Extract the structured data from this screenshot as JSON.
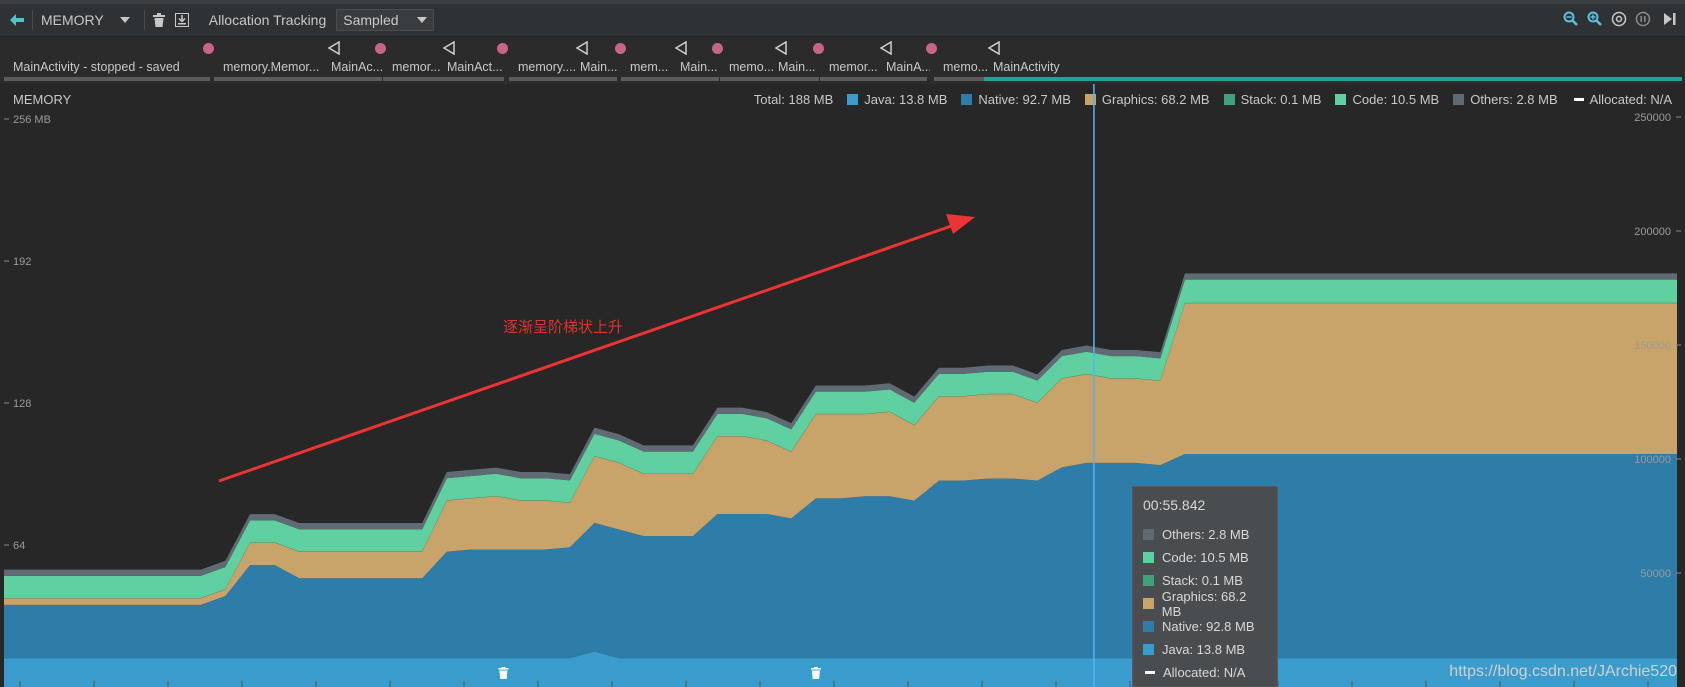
{
  "toolbar": {
    "back_icon": "back-arrow-icon",
    "memory_label": "MEMORY",
    "allocation_label": "Allocation Tracking",
    "sampling_value": "Sampled",
    "icons": [
      "delete-icon",
      "save-icon",
      "zoom-out-icon",
      "zoom-in-icon",
      "reset-zoom-icon",
      "pause-icon",
      "jump-to-end-icon"
    ]
  },
  "events": [
    {
      "label": "MainActivity - stopped - saved"
    },
    {
      "label": "memory.Memor..."
    },
    {
      "label": "MainAc..."
    },
    {
      "label": "memor..."
    },
    {
      "label": "MainAct..."
    },
    {
      "label": "memory...."
    },
    {
      "label": "Main..."
    },
    {
      "label": "mem..."
    },
    {
      "label": "Main..."
    },
    {
      "label": "memo..."
    },
    {
      "label": "Main..."
    },
    {
      "label": "memor..."
    },
    {
      "label": "MainA..."
    },
    {
      "label": "memo..."
    },
    {
      "label": "MainActivity"
    }
  ],
  "memory_panel": {
    "title": "MEMORY",
    "legend": {
      "total": "Total: 188 MB",
      "java": "Java: 13.8 MB",
      "native": "Native: 92.7 MB",
      "graphics": "Graphics: 68.2 MB",
      "stack": "Stack: 0.1 MB",
      "code": "Code: 10.5 MB",
      "others": "Others: 2.8 MB",
      "allocated": "Allocated: N/A"
    },
    "colors": {
      "java": "#3a9ccc",
      "native": "#2e7ca8",
      "graphics": "#c9a46a",
      "stack": "#3fa27a",
      "code": "#61d0a0",
      "others": "#5f6b74",
      "cursor": "#5ab0f0"
    }
  },
  "annotation": "逐渐呈阶梯状上升",
  "tooltip": {
    "time": "00:55.842",
    "rows": [
      {
        "label": "Others: 2.8 MB",
        "color": "#5f6b74"
      },
      {
        "label": "Code: 10.5 MB",
        "color": "#61d0a0"
      },
      {
        "label": "Stack: 0.1 MB",
        "color": "#3fa27a"
      },
      {
        "label": "Graphics: 68.2 MB",
        "color": "#c9a46a"
      },
      {
        "label": "Native: 92.8 MB",
        "color": "#2e7ca8"
      },
      {
        "label": "Java: 13.8 MB",
        "color": "#3a9ccc"
      },
      {
        "label": "Allocated: N/A",
        "color": "#ffffff"
      }
    ]
  },
  "watermark": "https://blog.csdn.net/JArchie520",
  "chart_data": {
    "type": "area",
    "stacked": true,
    "left_axis": {
      "unit": "MB",
      "ticks": [
        "256 MB",
        "192",
        "128",
        "64"
      ],
      "range": [
        0,
        256
      ]
    },
    "right_axis": {
      "ticks": [
        "250000",
        "200000",
        "150000",
        "100000",
        "50000"
      ],
      "range": [
        0,
        250000
      ]
    },
    "grid": false,
    "legend_position": "top-right",
    "x": [
      0,
      1,
      2,
      3,
      4,
      5,
      6,
      7,
      8,
      9,
      10,
      11,
      12,
      13,
      14,
      15,
      16,
      17,
      18,
      19,
      20,
      21,
      22,
      23,
      24,
      25,
      26,
      27,
      28,
      29,
      30,
      31,
      32,
      33,
      34,
      35,
      36,
      37,
      38,
      39,
      40,
      41,
      42,
      43,
      44,
      45,
      46,
      47,
      48,
      49,
      50,
      51,
      52,
      53,
      54,
      55,
      56,
      57,
      58,
      59,
      60,
      61,
      62,
      63,
      64,
      65,
      66,
      67,
      68
    ],
    "series": [
      {
        "name": "Java",
        "values": [
          13,
          13,
          13,
          13,
          13,
          13,
          13,
          13,
          13,
          13,
          13,
          13,
          13,
          13,
          13,
          13,
          13,
          13,
          13,
          13,
          13,
          13,
          13,
          13,
          16,
          13,
          13,
          13,
          13,
          13,
          13,
          13,
          13,
          13,
          13,
          13,
          13,
          13,
          13,
          13,
          13,
          13,
          13,
          13,
          13,
          13,
          13,
          13,
          13,
          13,
          13,
          13,
          13,
          13,
          13,
          13,
          13,
          13,
          13,
          13,
          13,
          13,
          13,
          13,
          13,
          13,
          13,
          13,
          13
        ]
      },
      {
        "name": "Native",
        "values": [
          24,
          24,
          24,
          24,
          24,
          24,
          24,
          24,
          24,
          28,
          42,
          42,
          36,
          36,
          36,
          36,
          36,
          36,
          48,
          49,
          49,
          49,
          49,
          50,
          58,
          58,
          55,
          55,
          55,
          65,
          65,
          65,
          63,
          72,
          72,
          73,
          73,
          71,
          80,
          80,
          81,
          81,
          80,
          86,
          88,
          88,
          88,
          87,
          92,
          92,
          92,
          92,
          92,
          92,
          92,
          92,
          92,
          92,
          92,
          92,
          92,
          92,
          92,
          92,
          92,
          92,
          92,
          92,
          92
        ]
      },
      {
        "name": "Graphics",
        "values": [
          3,
          3,
          3,
          3,
          3,
          3,
          3,
          3,
          3,
          3,
          10,
          10,
          12,
          12,
          12,
          12,
          12,
          12,
          23,
          23,
          24,
          22,
          22,
          20,
          30,
          30,
          28,
          28,
          28,
          35,
          35,
          33,
          30,
          38,
          38,
          37,
          38,
          34,
          38,
          38,
          38,
          38,
          35,
          40,
          40,
          38,
          38,
          38,
          68,
          68,
          68,
          68,
          68,
          68,
          68,
          68,
          68,
          68,
          68,
          68,
          68,
          68,
          68,
          68,
          68,
          68,
          68,
          68,
          68
        ]
      },
      {
        "name": "Stack",
        "values": [
          0.1,
          0.1,
          0.1,
          0.1,
          0.1,
          0.1,
          0.1,
          0.1,
          0.1,
          0.1,
          0.1,
          0.1,
          0.1,
          0.1,
          0.1,
          0.1,
          0.1,
          0.1,
          0.1,
          0.1,
          0.1,
          0.1,
          0.1,
          0.1,
          0.1,
          0.1,
          0.1,
          0.1,
          0.1,
          0.1,
          0.1,
          0.1,
          0.1,
          0.1,
          0.1,
          0.1,
          0.1,
          0.1,
          0.1,
          0.1,
          0.1,
          0.1,
          0.1,
          0.1,
          0.1,
          0.1,
          0.1,
          0.1,
          0.1,
          0.1,
          0.1,
          0.1,
          0.1,
          0.1,
          0.1,
          0.1,
          0.1,
          0.1,
          0.1,
          0.1,
          0.1,
          0.1,
          0.1,
          0.1,
          0.1,
          0.1,
          0.1,
          0.1,
          0.1
        ]
      },
      {
        "name": "Code",
        "values": [
          10,
          10,
          10,
          10,
          10,
          10,
          10,
          10,
          10,
          10,
          10,
          10,
          10,
          10,
          10,
          10,
          10,
          10,
          10,
          10,
          10,
          10,
          10,
          10,
          10,
          10,
          10,
          10,
          10,
          10,
          10,
          10,
          10,
          10,
          10,
          10,
          10,
          10,
          10,
          10,
          10,
          10,
          10,
          10,
          10,
          10,
          10,
          10,
          10.5,
          10.5,
          10.5,
          10.5,
          10.5,
          10.5,
          10.5,
          10.5,
          10.5,
          10.5,
          10.5,
          10.5,
          10.5,
          10.5,
          10.5,
          10.5,
          10.5,
          10.5,
          10.5,
          10.5,
          10.5
        ]
      },
      {
        "name": "Others",
        "values": [
          2.8,
          2.8,
          2.8,
          2.8,
          2.8,
          2.8,
          2.8,
          2.8,
          2.8,
          2.8,
          2.8,
          2.8,
          2.8,
          2.8,
          2.8,
          2.8,
          2.8,
          2.8,
          2.8,
          2.8,
          2.8,
          2.8,
          2.8,
          2.8,
          2.8,
          2.8,
          2.8,
          2.8,
          2.8,
          2.8,
          2.8,
          2.8,
          2.8,
          2.8,
          2.8,
          2.8,
          2.8,
          2.8,
          2.8,
          2.8,
          2.8,
          2.8,
          2.8,
          2.8,
          2.8,
          2.8,
          2.8,
          2.8,
          2.8,
          2.8,
          2.8,
          2.8,
          2.8,
          2.8,
          2.8,
          2.8,
          2.8,
          2.8,
          2.8,
          2.8,
          2.8,
          2.8,
          2.8,
          2.8,
          2.8,
          2.8,
          2.8,
          2.8,
          2.8
        ]
      }
    ],
    "cursor_x": 44.3,
    "gc_marker_x": [
      20.3,
      33.0
    ]
  }
}
